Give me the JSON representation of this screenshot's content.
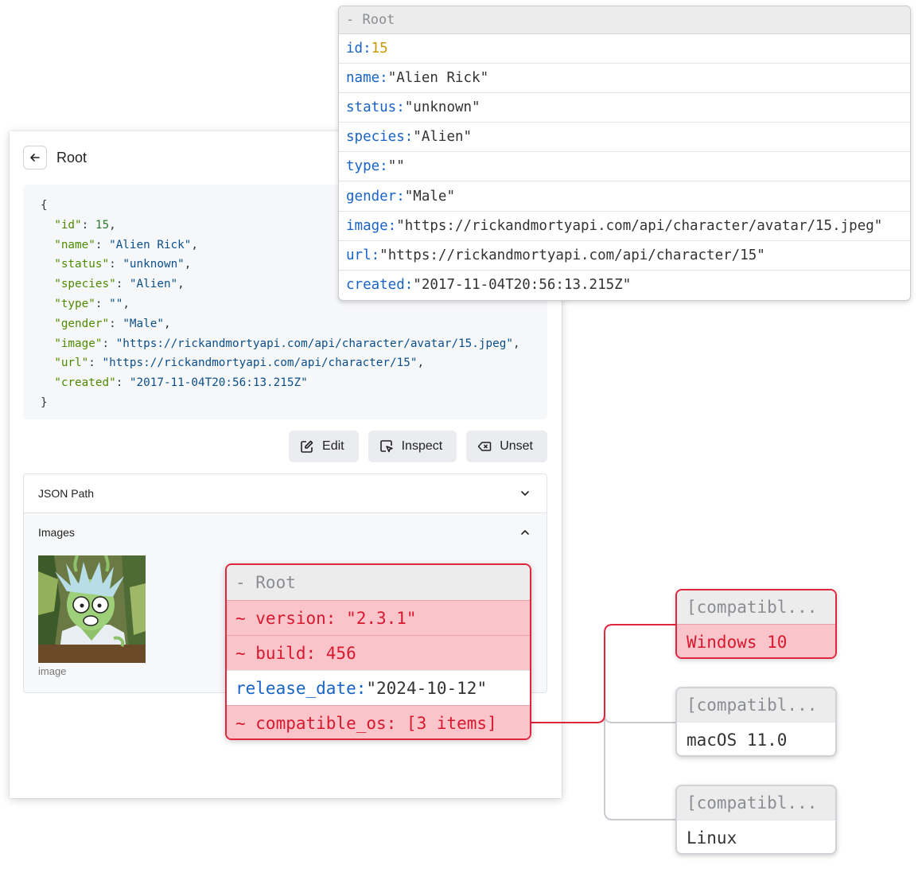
{
  "panel": {
    "title": "Root",
    "json_lines": [
      {
        "open": "{"
      },
      {
        "key": "\"id\"",
        "num": "15",
        "comma": ","
      },
      {
        "key": "\"name\"",
        "str": "\"Alien Rick\"",
        "comma": ","
      },
      {
        "key": "\"status\"",
        "str": "\"unknown\"",
        "comma": ","
      },
      {
        "key": "\"species\"",
        "str": "\"Alien\"",
        "comma": ","
      },
      {
        "key": "\"type\"",
        "str": "\"\"",
        "comma": ","
      },
      {
        "key": "\"gender\"",
        "str": "\"Male\"",
        "comma": ","
      },
      {
        "key": "\"image\"",
        "str": "\"https://rickandmortyapi.com/api/character/avatar/15.jpeg\"",
        "comma": ","
      },
      {
        "key": "\"url\"",
        "str": "\"https://rickandmortyapi.com/api/character/15\"",
        "comma": ","
      },
      {
        "key": "\"created\"",
        "str": "\"2017-11-04T20:56:13.215Z\"",
        "comma": ""
      },
      {
        "open": "}"
      }
    ],
    "buttons": {
      "edit": "Edit",
      "inspect": "Inspect",
      "unset": "Unset"
    },
    "accordion": {
      "json_path_label": "JSON Path",
      "images_label": "Images",
      "image_caption": "image"
    }
  },
  "inspector": {
    "header": "- Root",
    "rows": [
      {
        "key": "id:",
        "value": "15",
        "kind": "number"
      },
      {
        "key": "name:",
        "value": "\"Alien Rick\"",
        "kind": "string"
      },
      {
        "key": "status:",
        "value": "\"unknown\"",
        "kind": "string"
      },
      {
        "key": "species:",
        "value": "\"Alien\"",
        "kind": "string"
      },
      {
        "key": "type:",
        "value": "\"\"",
        "kind": "string"
      },
      {
        "key": "gender:",
        "value": "\"Male\"",
        "kind": "string"
      },
      {
        "key": "image:",
        "value": "\"https://rickandmortyapi.com/api/character/avatar/15.jpeg\"",
        "kind": "string"
      },
      {
        "key": "url:",
        "value": "\"https://rickandmortyapi.com/api/character/15\"",
        "kind": "string"
      },
      {
        "key": "created:",
        "value": "\"2017-11-04T20:56:13.215Z\"",
        "kind": "string"
      }
    ]
  },
  "diff_node": {
    "header": "- Root",
    "rows": [
      {
        "text": "~ version: \"2.3.1\"",
        "changed": true
      },
      {
        "text": "~ build: 456",
        "changed": true
      },
      {
        "key": "release_date:",
        "value": "\"2024-10-12\"",
        "changed": false
      },
      {
        "text": "~ compatible_os: [3 items]",
        "changed": true
      }
    ]
  },
  "array_items": [
    {
      "header": "[compatibl...",
      "value": "Windows 10",
      "changed": true
    },
    {
      "header": "[compatibl...",
      "value": "macOS 11.0",
      "changed": false
    },
    {
      "header": "[compatibl...",
      "value": "Linux",
      "changed": false
    }
  ],
  "colors": {
    "key_blue": "#1763c6",
    "number_gold": "#c99a06",
    "diff_red": "#e0253d",
    "diff_bg": "#f9c5ca"
  }
}
